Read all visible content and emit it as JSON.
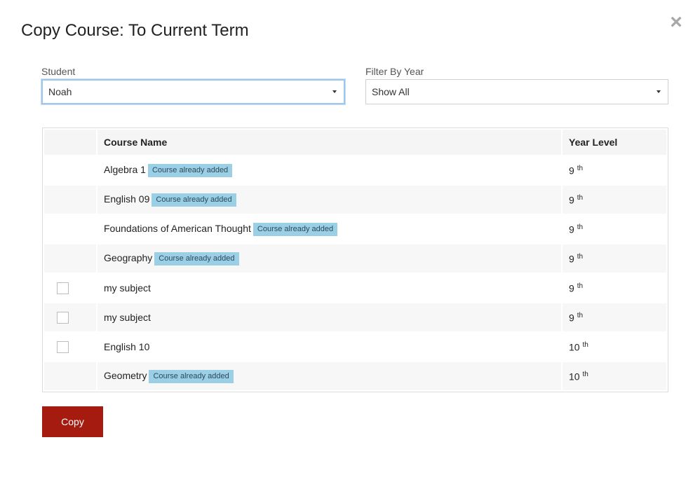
{
  "modal": {
    "title": "Copy Course: To Current Term",
    "close_glyph": "×"
  },
  "student": {
    "label": "Student",
    "value": "Noah"
  },
  "filter": {
    "label": "Filter By Year",
    "value": "Show All"
  },
  "table": {
    "headers": [
      "",
      "Course Name",
      "Year Level"
    ],
    "badge_text": "Course already added",
    "rows": [
      {
        "name": "Algebra 1",
        "already_added": true,
        "year": "9",
        "suffix": "th"
      },
      {
        "name": "English 09",
        "already_added": true,
        "year": "9",
        "suffix": "th"
      },
      {
        "name": "Foundations of American Thought",
        "already_added": true,
        "year": "9",
        "suffix": "th"
      },
      {
        "name": "Geography",
        "already_added": true,
        "year": "9",
        "suffix": "th"
      },
      {
        "name": "my subject",
        "already_added": false,
        "year": "9",
        "suffix": "th"
      },
      {
        "name": "my subject",
        "already_added": false,
        "year": "9",
        "suffix": "th"
      },
      {
        "name": "English 10",
        "already_added": false,
        "year": "10",
        "suffix": "th"
      },
      {
        "name": "Geometry",
        "already_added": true,
        "year": "10",
        "suffix": "th"
      }
    ]
  },
  "actions": {
    "copy_label": "Copy"
  },
  "colors": {
    "primary_button": "#a51b0f",
    "badge": "#9bcfe6",
    "focus_ring": "#9ec6ea"
  }
}
